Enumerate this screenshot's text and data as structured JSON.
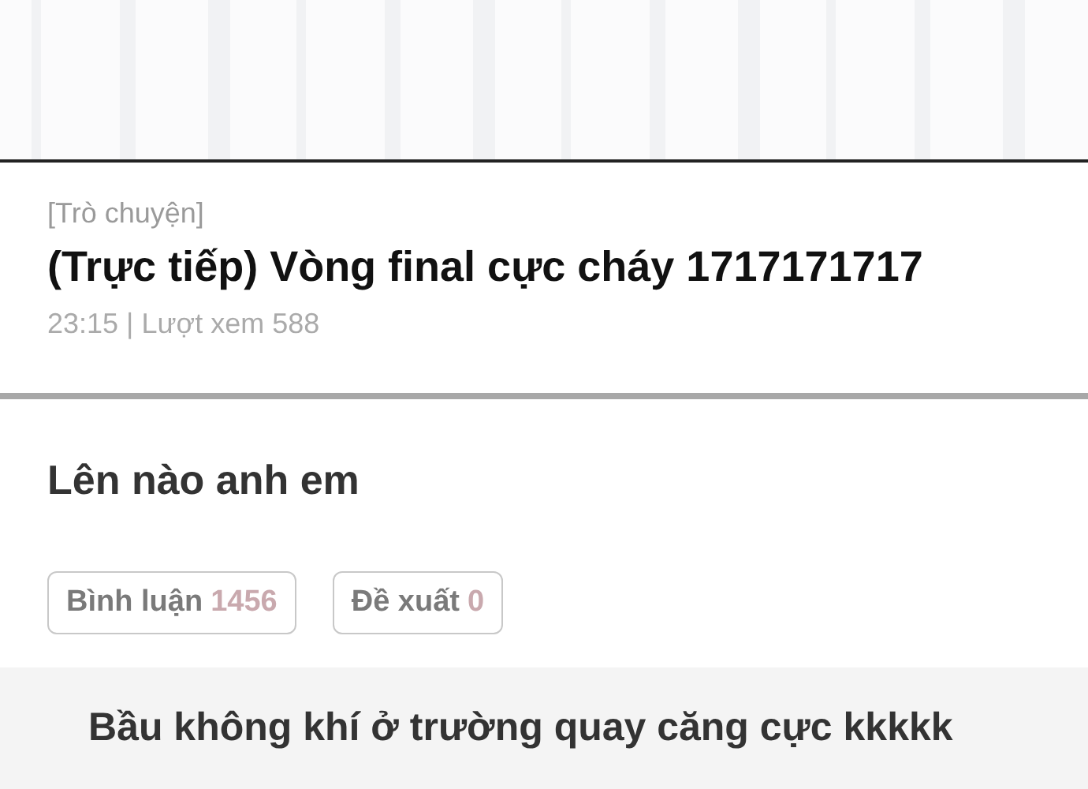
{
  "header": {
    "category": "[Trò chuyện]",
    "title": "(Trực tiếp) Vòng final cực cháy 1717171717",
    "meta": "23:15 | Lượt xem 588"
  },
  "post": {
    "text": "Lên nào anh em"
  },
  "actions": [
    {
      "label": "Bình luận",
      "count": "1456"
    },
    {
      "label": "Đề xuất",
      "count": "0"
    }
  ],
  "comment": {
    "text": "Bầu không khí ở trường quay căng cực kkkkk"
  }
}
